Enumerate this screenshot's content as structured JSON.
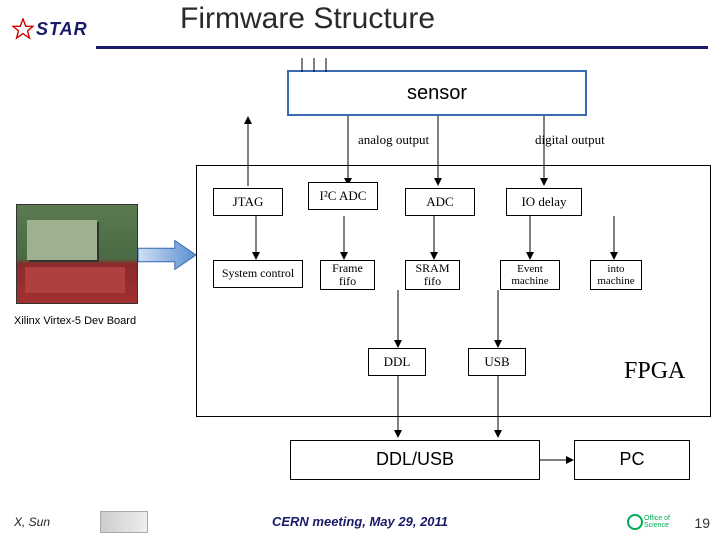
{
  "logo": {
    "text": "STAR"
  },
  "title": "Firmware Structure",
  "sensor": {
    "label": "sensor"
  },
  "outputs": {
    "analog": "analog output",
    "digital": "digital output"
  },
  "fpga": {
    "label": "FPGA",
    "row1": {
      "jtag": "JTAG",
      "i2cadc": "I²C ADC",
      "adc": "ADC",
      "iodelay": "IO delay"
    },
    "row2": {
      "sysctl": "System control",
      "framefifo": "Frame\nfifo",
      "sramfifo": "SRAM\nfifo",
      "evtmach": "Event\nmachine",
      "intomach": "into\nmachine"
    },
    "row3": {
      "ddl": "DDL",
      "usb": "USB"
    }
  },
  "bottom": {
    "ddlusb": "DDL/USB",
    "pc": "PC"
  },
  "board_caption": "Xilinx Virtex-5 Dev Board",
  "footer": {
    "author": "X, Sun",
    "meeting": "CERN meeting, May 29, 2011",
    "page": "19",
    "office": "Office of Science"
  }
}
